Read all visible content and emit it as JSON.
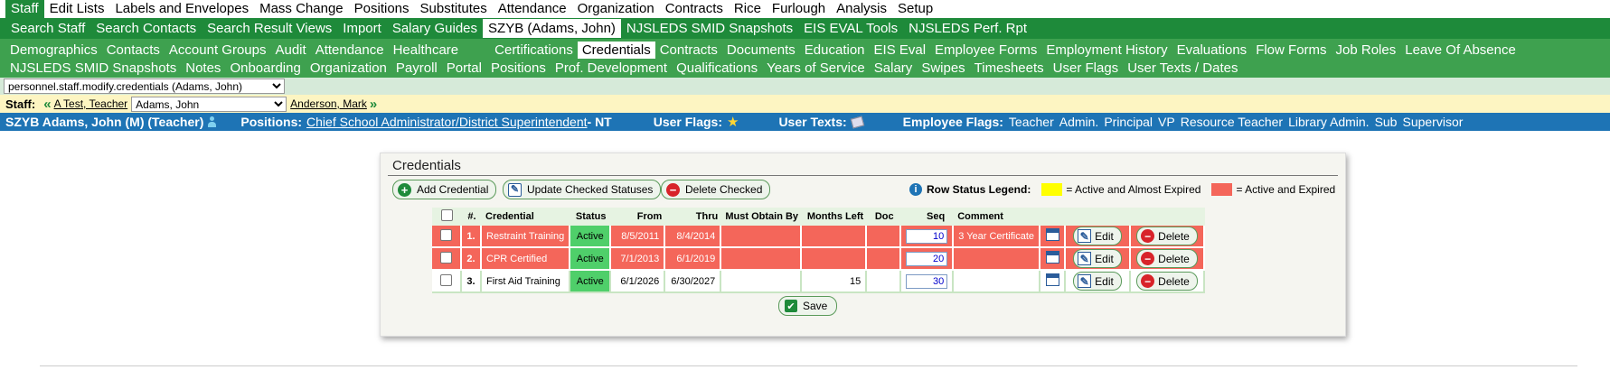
{
  "menu": [
    "Staff",
    "Edit Lists",
    "Labels and Envelopes",
    "Mass Change",
    "Positions",
    "Substitutes",
    "Attendance",
    "Organization",
    "Contracts",
    "Rice",
    "Furlough",
    "Analysis",
    "Setup"
  ],
  "tabs1": [
    "Search Staff",
    "Search Contacts",
    "Search Result Views",
    "Import",
    "Salary Guides",
    "SZYB (Adams, John)",
    "NJSLEDS SMID Snapshots",
    "EIS EVAL Tools",
    "NJSLEDS Perf. Rpt"
  ],
  "tabs2_row1": [
    "Demographics",
    "Contacts",
    "Account Groups",
    "Audit",
    "Attendance",
    "Healthcare",
    "Certifications",
    "Credentials",
    "Contracts",
    "Documents",
    "Education",
    "EIS Eval",
    "Employee Forms",
    "Employment History",
    "Evaluations",
    "Flow Forms",
    "Job Roles",
    "Leave Of Absence"
  ],
  "tabs2_row2": [
    "NJSLEDS SMID Snapshots",
    "Notes",
    "Onboarding",
    "Organization",
    "Payroll",
    "Portal",
    "Positions",
    "Prof. Development",
    "Qualifications",
    "Years of Service",
    "Salary",
    "Swipes",
    "Timesheets",
    "User Flags",
    "User Texts / Dates"
  ],
  "path_select": "personnel.staff.modify.credentials (Adams, John)",
  "staff_nav": {
    "label": "Staff:",
    "prev": "A Test, Teacher",
    "current": "Adams, John",
    "next": "Anderson, Mark"
  },
  "info": {
    "name": "SZYB Adams, John (M) (Teacher)",
    "positions_label": "Positions:",
    "positions_link": "Chief School Administrator/District Superintendent",
    "positions_suffix": " - NT",
    "user_flags_label": "User Flags:",
    "user_texts_label": "User Texts:",
    "employee_flags_label": "Employee Flags:",
    "employee_flags": [
      "Teacher",
      "Admin.",
      "Principal",
      "VP",
      "Resource Teacher",
      "Library Admin.",
      "Sub",
      "Supervisor"
    ]
  },
  "panel": {
    "title": "Credentials",
    "add_label": "Add Credential",
    "update_label": "Update Checked Statuses",
    "delete_checked_label": "Delete Checked",
    "legend_title": "Row Status Legend:",
    "legend_yellow": "= Active and Almost Expired",
    "legend_red": "= Active and Expired",
    "save_label": "Save",
    "headers": [
      "#.",
      "Credential",
      "Status",
      "From",
      "Thru",
      "Must Obtain By",
      "Months Left",
      "Doc",
      "Seq",
      "Comment"
    ],
    "rows": [
      {
        "num": "1.",
        "credential": "Restraint Training",
        "status": "Active",
        "from": "8/5/2011",
        "thru": "8/4/2014",
        "must": "",
        "months": "",
        "doc": "",
        "seq": "10",
        "comment": "3 Year Certificate",
        "state": "red"
      },
      {
        "num": "2.",
        "credential": "CPR Certified",
        "status": "Active",
        "from": "7/1/2013",
        "thru": "6/1/2019",
        "must": "",
        "months": "",
        "doc": "",
        "seq": "20",
        "comment": "",
        "state": "red"
      },
      {
        "num": "3.",
        "credential": "First Aid Training",
        "status": "Active",
        "from": "6/1/2026",
        "thru": "6/30/2027",
        "must": "",
        "months": "15",
        "doc": "",
        "seq": "30",
        "comment": "",
        "state": "white"
      }
    ],
    "edit_label": "Edit",
    "delete_label": "Delete"
  },
  "colors": {
    "green_dark": "#1e8a3a",
    "green_light": "#3ea14f",
    "blue_bar": "#1e74b5",
    "expired_red": "#f4665a",
    "almost_yellow": "#ffff00",
    "status_green": "#4fcf6a"
  }
}
